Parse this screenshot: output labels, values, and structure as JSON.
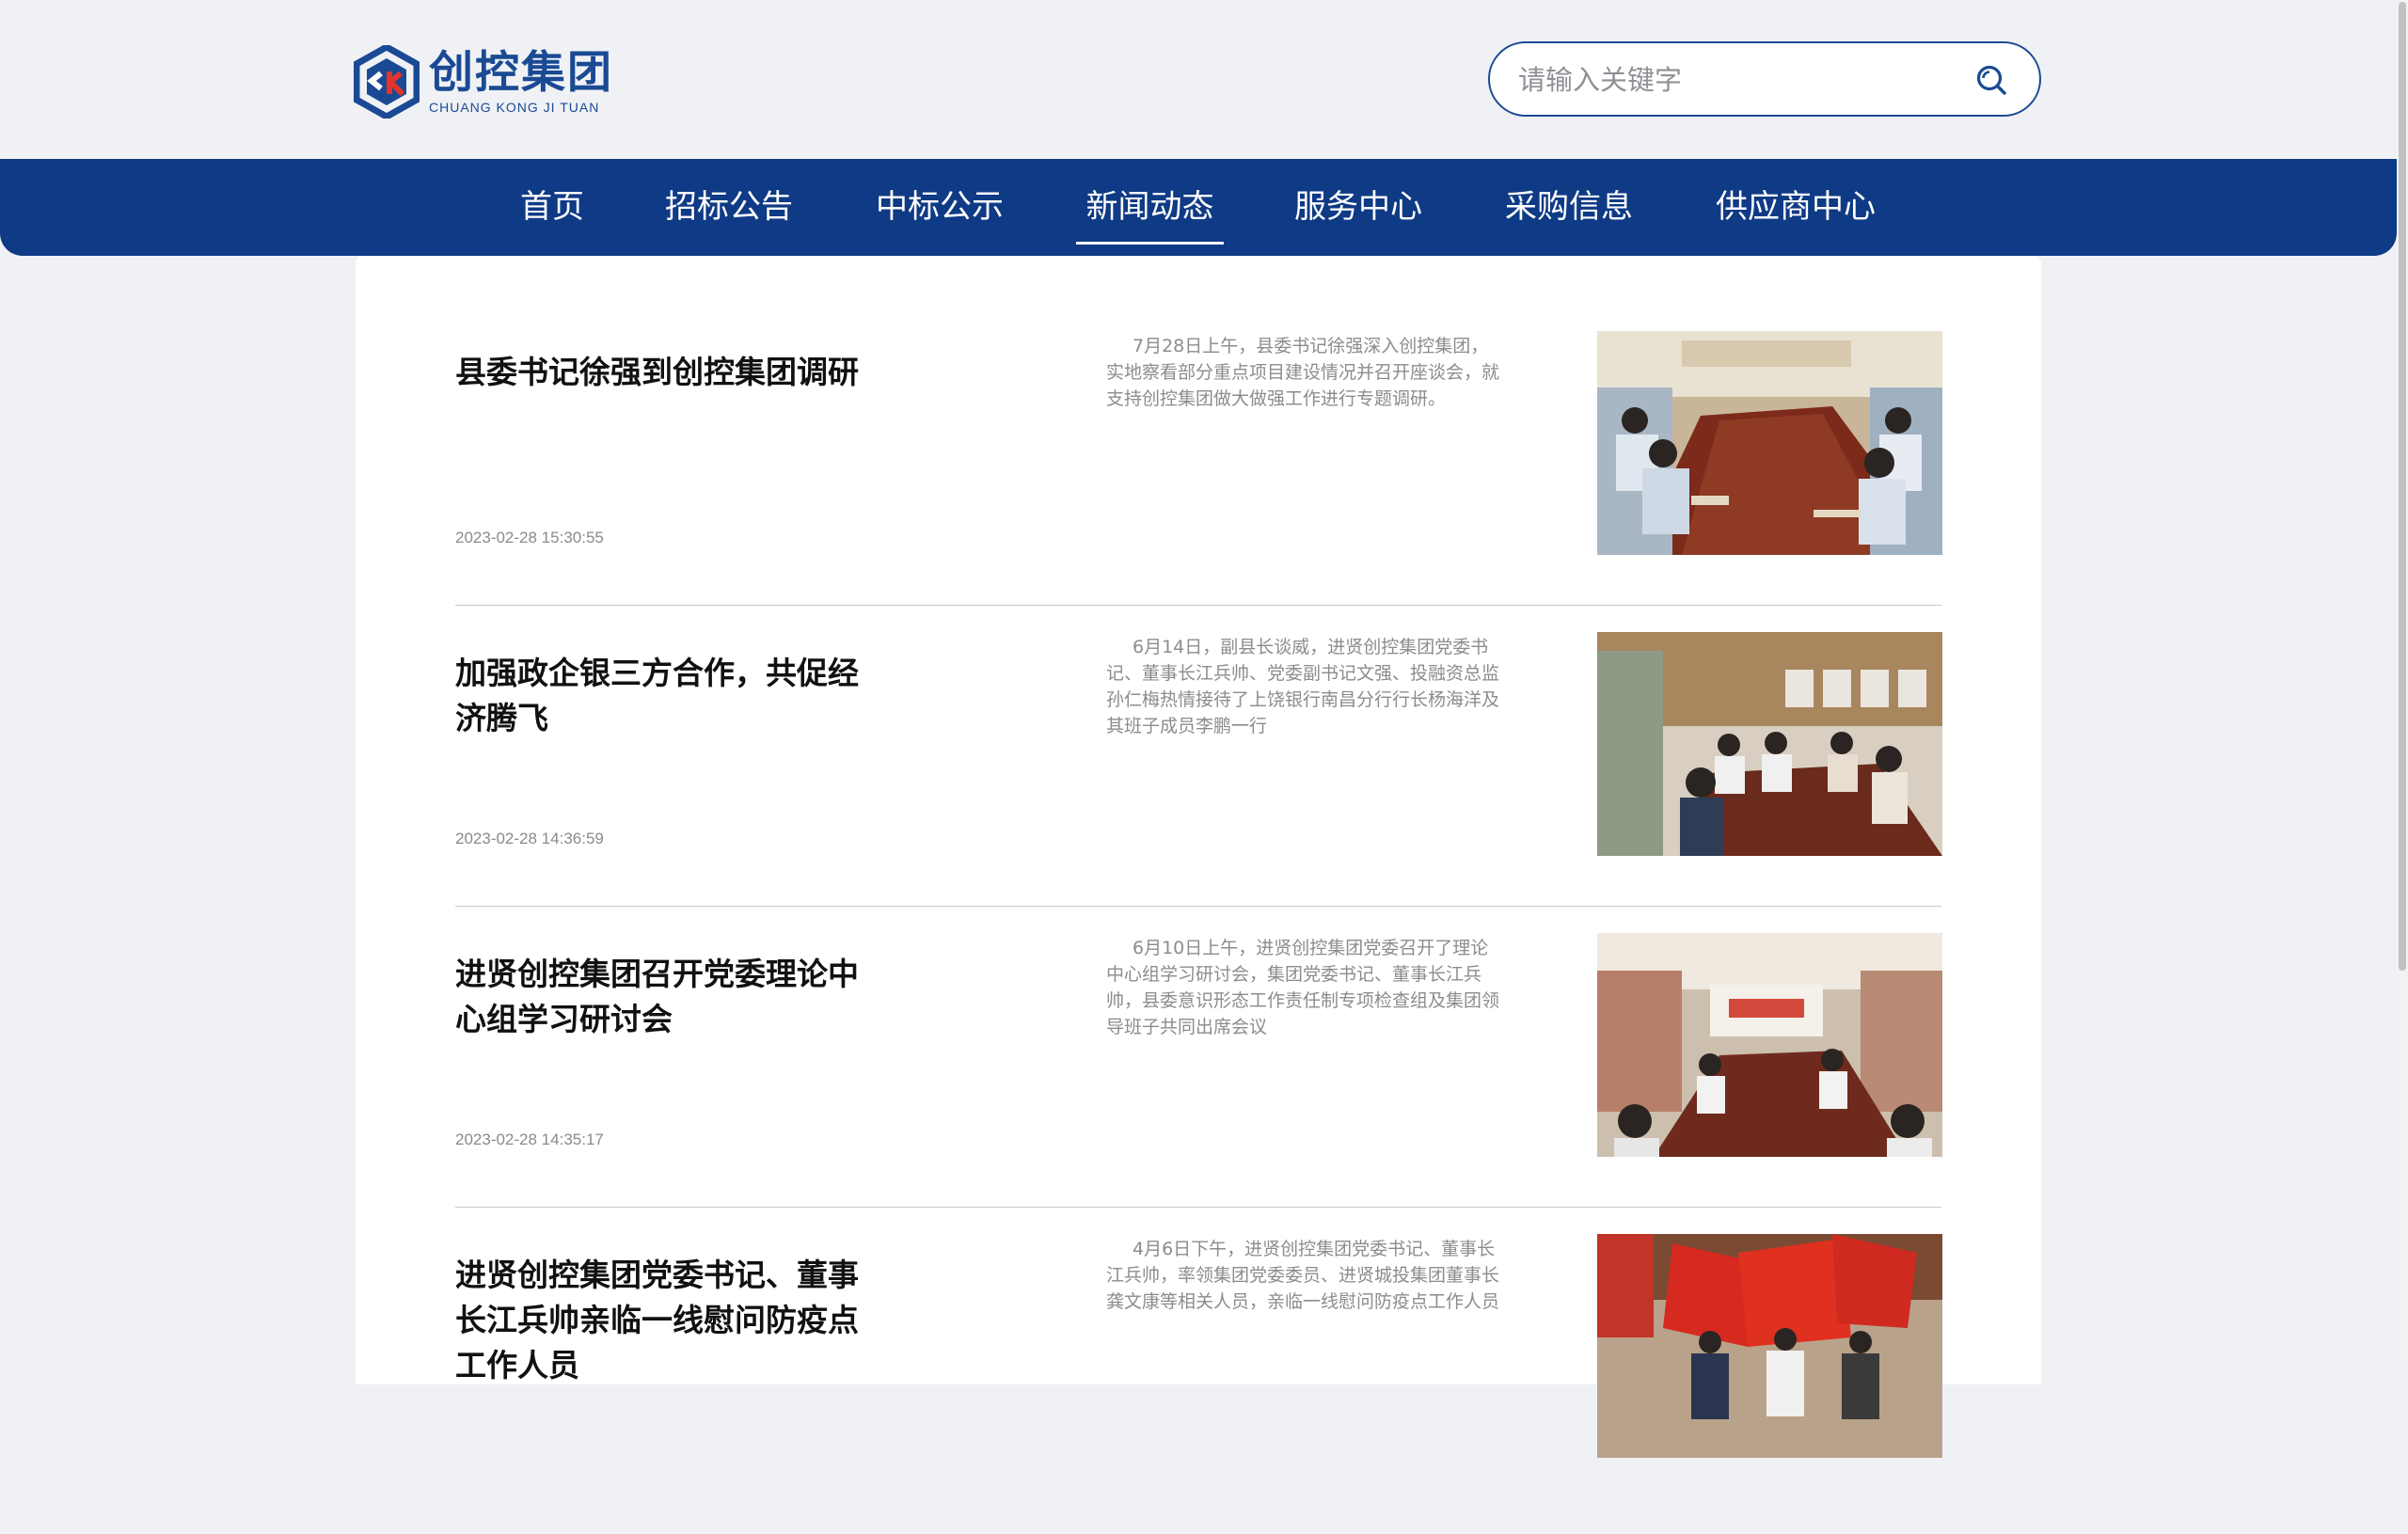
{
  "logo": {
    "name_cn": "创控集团",
    "name_en": "CHUANG KONG JI TUAN",
    "mark": "ck-cube-logo"
  },
  "search": {
    "placeholder": "请输入关键字",
    "icon": "search-icon"
  },
  "nav": {
    "items": [
      {
        "label": "首页"
      },
      {
        "label": "招标公告"
      },
      {
        "label": "中标公示"
      },
      {
        "label": "新闻动态",
        "active": true
      },
      {
        "label": "服务中心"
      },
      {
        "label": "采购信息"
      },
      {
        "label": "供应商中心"
      }
    ]
  },
  "articles": [
    {
      "title": "县委书记徐强到创控集团调研",
      "date": "2023-02-28 15:30:55",
      "summary": "7月28日上午，县委书记徐强深入创控集团，实地察看部分重点项目建设情况并召开座谈会，就支持创控集团做大做强工作进行专题调研。"
    },
    {
      "title": "加强政企银三方合作，共促经济腾飞",
      "date": "2023-02-28 14:36:59",
      "summary": "6月14日，副县长谈威，进贤创控集团党委书记、董事长江兵帅、党委副书记文强、投融资总监孙仁梅热情接待了上饶银行南昌分行行长杨海洋及其班子成员李鹏一行"
    },
    {
      "title": "进贤创控集团召开党委理论中心组学习研讨会",
      "date": "2023-02-28 14:35:17",
      "summary": "6月10日上午，进贤创控集团党委召开了理论中心组学习研讨会，集团党委书记、董事长江兵帅，县委意识形态工作责任制专项检查组及集团领导班子共同出席会议"
    },
    {
      "title": "进贤创控集团党委书记、董事长江兵帅亲临一线慰问防疫点工作人员",
      "date": "",
      "summary": "4月6日下午，进贤创控集团党委书记、董事长江兵帅，率领集团党委委员、进贤城投集团董事长龚文康等相关人员，亲临一线慰问防疫点工作人员"
    }
  ]
}
